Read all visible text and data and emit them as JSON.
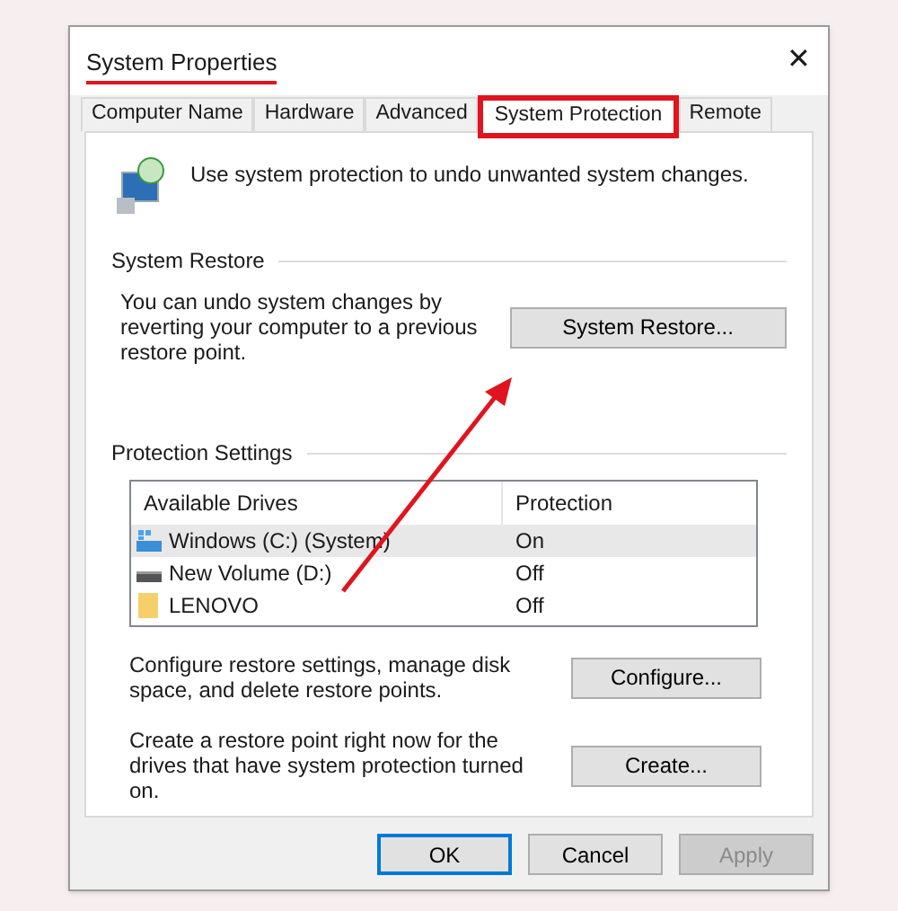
{
  "window": {
    "title": "System Properties",
    "close": "✕"
  },
  "tabs": [
    {
      "label": "Computer Name",
      "selected": false
    },
    {
      "label": "Hardware",
      "selected": false
    },
    {
      "label": "Advanced",
      "selected": false
    },
    {
      "label": "System Protection",
      "selected": true
    },
    {
      "label": "Remote",
      "selected": false
    }
  ],
  "intro": "Use system protection to undo unwanted system changes.",
  "system_restore": {
    "heading": "System Restore",
    "text": "You can undo system changes by reverting your computer to a previous restore point.",
    "button": "System Restore..."
  },
  "protection_settings": {
    "heading": "Protection Settings",
    "columns": [
      "Available Drives",
      "Protection"
    ],
    "rows": [
      {
        "kind": "system-drive",
        "name": "Windows (C:) (System)",
        "protection": "On",
        "selected": true
      },
      {
        "kind": "drive",
        "name": "New Volume (D:)",
        "protection": "Off",
        "selected": false
      },
      {
        "kind": "folder",
        "name": "LENOVO",
        "protection": "Off",
        "selected": false
      }
    ],
    "actions": [
      {
        "text": "Configure restore settings, manage disk space, and delete restore points.",
        "button": "Configure..."
      },
      {
        "text": "Create a restore point right now for the drives that have system protection turned on.",
        "button": "Create..."
      }
    ]
  },
  "buttons": [
    {
      "label": "OK",
      "default": true,
      "disabled": false
    },
    {
      "label": "Cancel",
      "default": false,
      "disabled": false
    },
    {
      "label": "Apply",
      "default": false,
      "disabled": true
    }
  ]
}
